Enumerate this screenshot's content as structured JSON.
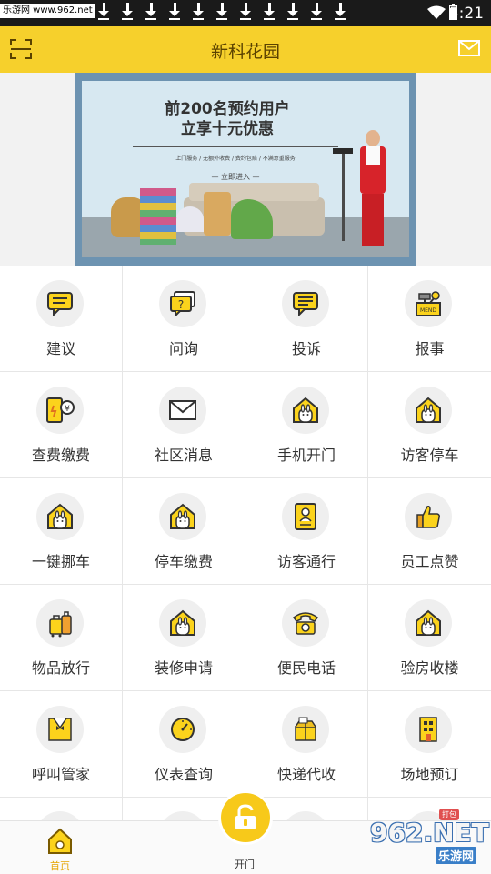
{
  "status_bar": {
    "watermark": "乐游网 www.962.net",
    "time": "5:21",
    "download_icon_count": 11
  },
  "header": {
    "title": "新科花园",
    "left_icon": "scan-icon",
    "right_icon": "mail-icon",
    "bg_color": "#f6d02c"
  },
  "banner": {
    "headline_1": "前200名预约用户",
    "headline_2": "立享十元优惠",
    "subline": "上门服务 / 无额外收费 / 费约包赔 / 不满意重服务",
    "cta": "立即进入"
  },
  "grid": {
    "items": [
      {
        "label": "建议",
        "icon": "chat-icon"
      },
      {
        "label": "问询",
        "icon": "question-icon"
      },
      {
        "label": "投诉",
        "icon": "complaint-icon"
      },
      {
        "label": "报事",
        "icon": "report-icon"
      },
      {
        "label": "查费缴费",
        "icon": "phone-payment-icon"
      },
      {
        "label": "社区消息",
        "icon": "envelope-icon"
      },
      {
        "label": "手机开门",
        "icon": "house-door-icon"
      },
      {
        "label": "访客停车",
        "icon": "house-door-icon"
      },
      {
        "label": "一键挪车",
        "icon": "house-door-icon"
      },
      {
        "label": "停车缴费",
        "icon": "house-door-icon"
      },
      {
        "label": "访客通行",
        "icon": "id-card-icon"
      },
      {
        "label": "员工点赞",
        "icon": "thumbs-up-icon"
      },
      {
        "label": "物品放行",
        "icon": "luggage-icon"
      },
      {
        "label": "装修申请",
        "icon": "house-door-icon"
      },
      {
        "label": "便民电话",
        "icon": "telephone-icon"
      },
      {
        "label": "验房收楼",
        "icon": "house-door-icon"
      },
      {
        "label": "呼叫管家",
        "icon": "butler-icon"
      },
      {
        "label": "仪表查询",
        "icon": "meter-icon"
      },
      {
        "label": "快递代收",
        "icon": "package-icon"
      },
      {
        "label": "场地预订",
        "icon": "building-icon"
      }
    ]
  },
  "bottom_nav": {
    "home_label": "首页",
    "unlock_label": "开门",
    "active_color": "#e5a400"
  },
  "watermark": {
    "badge": "打包",
    "number": "962.NET",
    "site": "乐游网"
  }
}
